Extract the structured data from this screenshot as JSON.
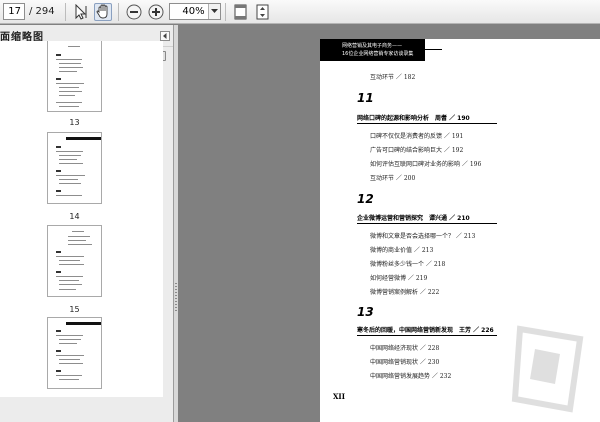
{
  "toolbar": {
    "current_page": "17",
    "total_pages": "/ 294",
    "zoom": "40%",
    "icons": [
      "select-tool-icon",
      "hand-tool-icon",
      "zoom-out-icon",
      "zoom-in-icon",
      "chevron-down-icon",
      "single-page-icon",
      "fit-page-icon"
    ]
  },
  "sidebar": {
    "title": "面缩略图",
    "thumbnails": [
      {
        "label": "13"
      },
      {
        "label": "14"
      },
      {
        "label": "15"
      }
    ]
  },
  "page": {
    "header_top": "网络营销及其电子商务——",
    "header_bottom": "16位企业网络营销专家访谈录集",
    "lines": [
      {
        "text": "互动环节 ／ 182"
      },
      {
        "text": "口碑不仅仅是消费者的反馈 ／ 191"
      },
      {
        "text": "广告可口碑的结合影响巨大 ／ 192"
      },
      {
        "text": "如何评估互联网口碑对业务的影响 ／ 196"
      },
      {
        "text": "互动环节 ／ 200"
      },
      {
        "text": "微博和文章是否会选择哪一个？ ／ 213"
      },
      {
        "text": "微博的商业价值 ／ 213"
      },
      {
        "text": "微博粉丝多少钱一个 ／ 218"
      },
      {
        "text": "如何经营微博 ／ 219"
      },
      {
        "text": "微博营销案例解析 ／ 222"
      },
      {
        "text": "中国网络经济现状 ／ 228"
      },
      {
        "text": "中国网络营销现状 ／ 230"
      },
      {
        "text": "中国网络营销发展趋势 ／ 232"
      }
    ],
    "chapters": [
      {
        "num": "11",
        "title": "网络口碑的起源和影响分析　周耆 ／ 190"
      },
      {
        "num": "12",
        "title": "企业微博运营和营销探究　谭兴通 ／ 210"
      },
      {
        "num": "13",
        "title": "寒冬后的回暖，中国网络营销新发现　王芳 ／ 226"
      }
    ],
    "folio": "XII"
  }
}
